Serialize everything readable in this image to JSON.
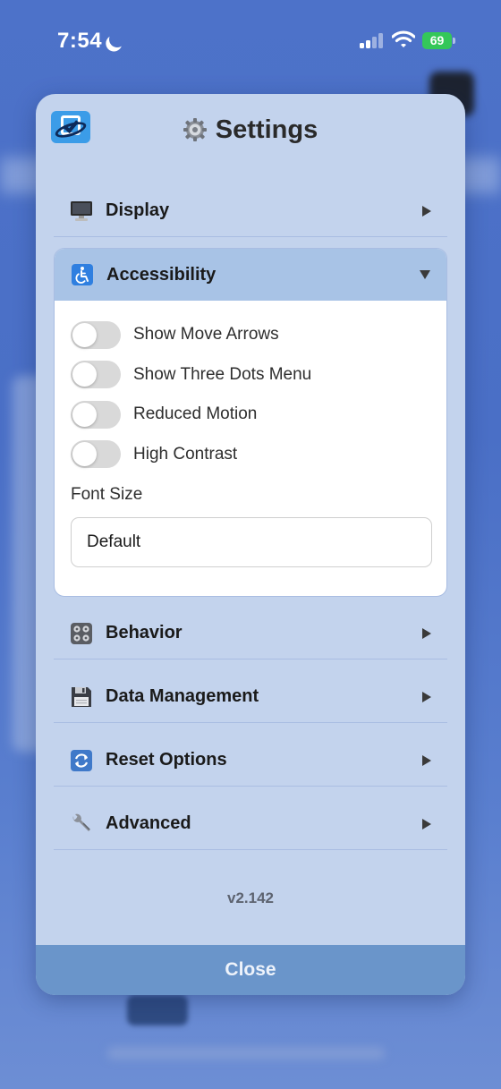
{
  "status_bar": {
    "time": "7:54",
    "battery": "69",
    "icons": [
      "moon-icon",
      "signal-icon",
      "wifi-icon",
      "battery-icon"
    ]
  },
  "modal": {
    "title": "Settings",
    "title_icon": "gear-icon",
    "app_icon": "checklist-app-icon",
    "sections": {
      "display": {
        "label": "Display",
        "icon": "monitor-icon",
        "expanded": false
      },
      "accessibility": {
        "label": "Accessibility",
        "icon": "wheelchair-icon",
        "expanded": true,
        "toggles": [
          {
            "label": "Show Move Arrows",
            "on": false
          },
          {
            "label": "Show Three Dots Menu",
            "on": false
          },
          {
            "label": "Reduced Motion",
            "on": false
          },
          {
            "label": "High Contrast",
            "on": false
          }
        ],
        "font_size_label": "Font Size",
        "font_size_value": "Default"
      },
      "behavior": {
        "label": "Behavior",
        "icon": "control-knobs-icon",
        "expanded": false
      },
      "data_management": {
        "label": "Data Management",
        "icon": "floppy-disk-icon",
        "expanded": false
      },
      "reset_options": {
        "label": "Reset Options",
        "icon": "refresh-icon",
        "expanded": false
      },
      "advanced": {
        "label": "Advanced",
        "icon": "wrench-icon",
        "expanded": false
      }
    },
    "version": "v2.142",
    "close_label": "Close"
  },
  "colors": {
    "background": "#4d72c9",
    "modal": "#c3d3ed",
    "accordion_header": "#a8c3e6",
    "close_bar": "#6a95ca",
    "battery": "#34c759"
  }
}
